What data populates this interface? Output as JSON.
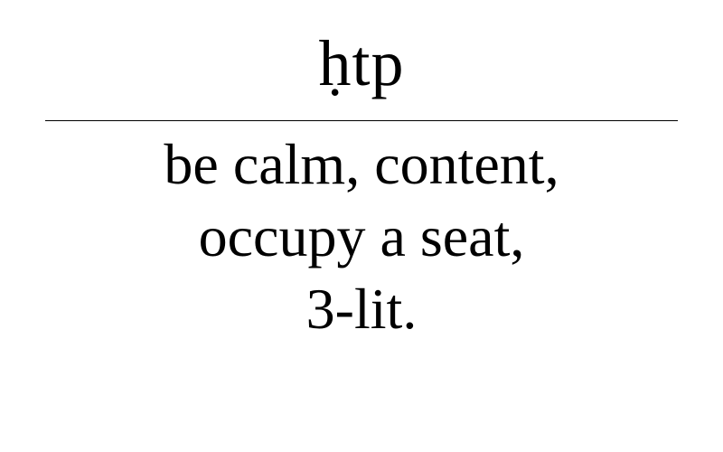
{
  "entry": {
    "headword": "ḥtp",
    "definition_lines": [
      "be calm, content,",
      "occupy a seat,",
      "3-lit."
    ]
  }
}
